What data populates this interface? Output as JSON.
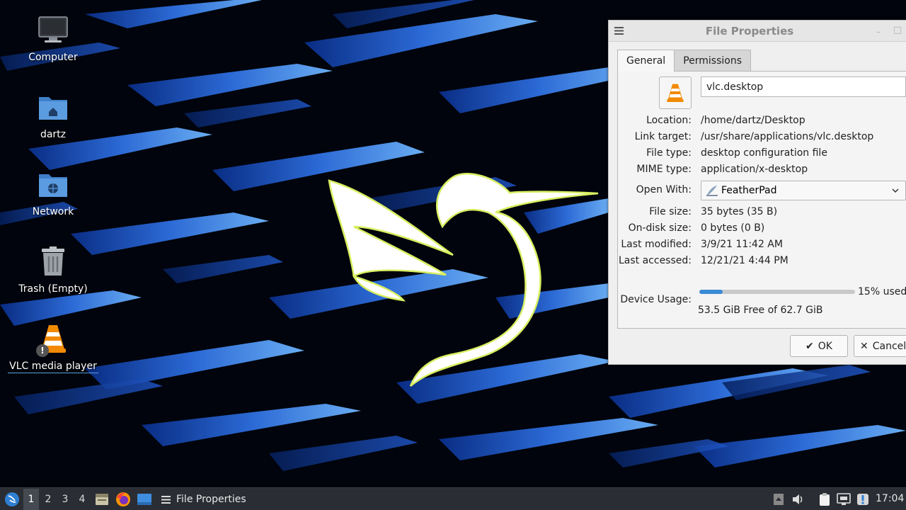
{
  "desktop": {
    "icons": [
      {
        "label": "Computer",
        "icon": "monitor-icon"
      },
      {
        "label": "dartz",
        "icon": "home-folder-icon"
      },
      {
        "label": "Network",
        "icon": "network-folder-icon"
      },
      {
        "label": "Trash (Empty)",
        "icon": "trash-icon"
      },
      {
        "label": "VLC media player",
        "icon": "vlc-icon"
      }
    ]
  },
  "dialog": {
    "title": "File Properties",
    "tabs": [
      {
        "label": "General",
        "active": true
      },
      {
        "label": "Permissions",
        "active": false
      }
    ],
    "filename": "vlc.desktop",
    "properties": [
      {
        "label": "Location:",
        "value": "/home/dartz/Desktop"
      },
      {
        "label": "Link target:",
        "value": "/usr/share/applications/vlc.desktop"
      },
      {
        "label": "File type:",
        "value": "desktop configuration file"
      },
      {
        "label": "MIME type:",
        "value": "application/x-desktop"
      }
    ],
    "open_with": {
      "label": "Open With:",
      "value": "FeatherPad",
      "icon": "featherpad-icon"
    },
    "sizes": [
      {
        "label": "File size:",
        "value": "35 bytes (35 B)"
      },
      {
        "label": "On-disk size:",
        "value": "0 bytes (0 B)"
      },
      {
        "label": "Last modified:",
        "value": "3/9/21 11:42 AM"
      },
      {
        "label": "Last accessed:",
        "value": "12/21/21 4:44 PM"
      }
    ],
    "device_usage": {
      "label": "Device Usage:",
      "percent": 15,
      "percent_text": "15% used",
      "free_text": "53.5 GiB Free of 62.7 GiB"
    },
    "buttons": {
      "ok": "OK",
      "cancel": "Cancel"
    }
  },
  "taskbar": {
    "workspaces": [
      "1",
      "2",
      "3",
      "4"
    ],
    "active_workspace": "1",
    "task_title": "File Properties",
    "clock": "17:04"
  },
  "colors": {
    "accent": "#3a8ad6",
    "taskbar": "#2a2d33",
    "vlc_orange": "#f28a00"
  }
}
